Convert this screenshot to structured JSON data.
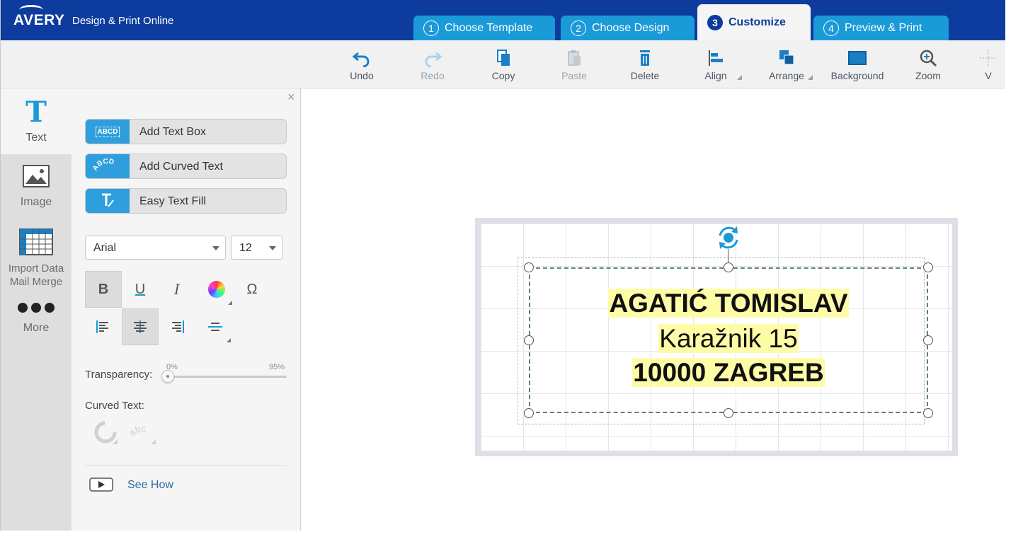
{
  "header": {
    "brand": "AVERY",
    "app_name": "Design & Print Online",
    "steps": [
      {
        "num": "1",
        "label": "Choose Template"
      },
      {
        "num": "2",
        "label": "Choose Design"
      },
      {
        "num": "3",
        "label": "Customize",
        "active": true
      },
      {
        "num": "4",
        "label": "Preview & Print"
      }
    ]
  },
  "toolbar": {
    "undo": "Undo",
    "redo": "Redo",
    "copy": "Copy",
    "paste": "Paste",
    "delete": "Delete",
    "align": "Align",
    "arrange": "Arrange",
    "background": "Background",
    "zoom": "Zoom",
    "view": "V"
  },
  "rail": {
    "text": "Text",
    "image": "Image",
    "import_line1": "Import Data",
    "import_line2": "Mail Merge",
    "more": "More"
  },
  "panel": {
    "close": "×",
    "add_text_box": "Add Text Box",
    "add_text_box_icon_text": "ABCD",
    "add_curved_text": "Add Curved Text",
    "add_curved_text_icon_text": "ABCD",
    "easy_text_fill": "Easy Text Fill",
    "font_family": "Arial",
    "font_size": "12",
    "bold": "B",
    "underline": "U",
    "italic": "I",
    "omega": "Ω",
    "transparency_label": "Transparency:",
    "transparency_min": "0%",
    "transparency_max": "95%",
    "curved_text_label": "Curved Text:",
    "curved_preview_text": "abc",
    "see_how": "See How"
  },
  "canvas": {
    "line1": "AGATIĆ TOMISLAV",
    "line2": "Karažnik 15",
    "line3": "10000 ZAGREB",
    "highlight_color": "#fffca8"
  },
  "colors": {
    "header_bg": "#0e3c9e",
    "step_tab": "#1b9ad8",
    "accent": "#2f9edc"
  }
}
